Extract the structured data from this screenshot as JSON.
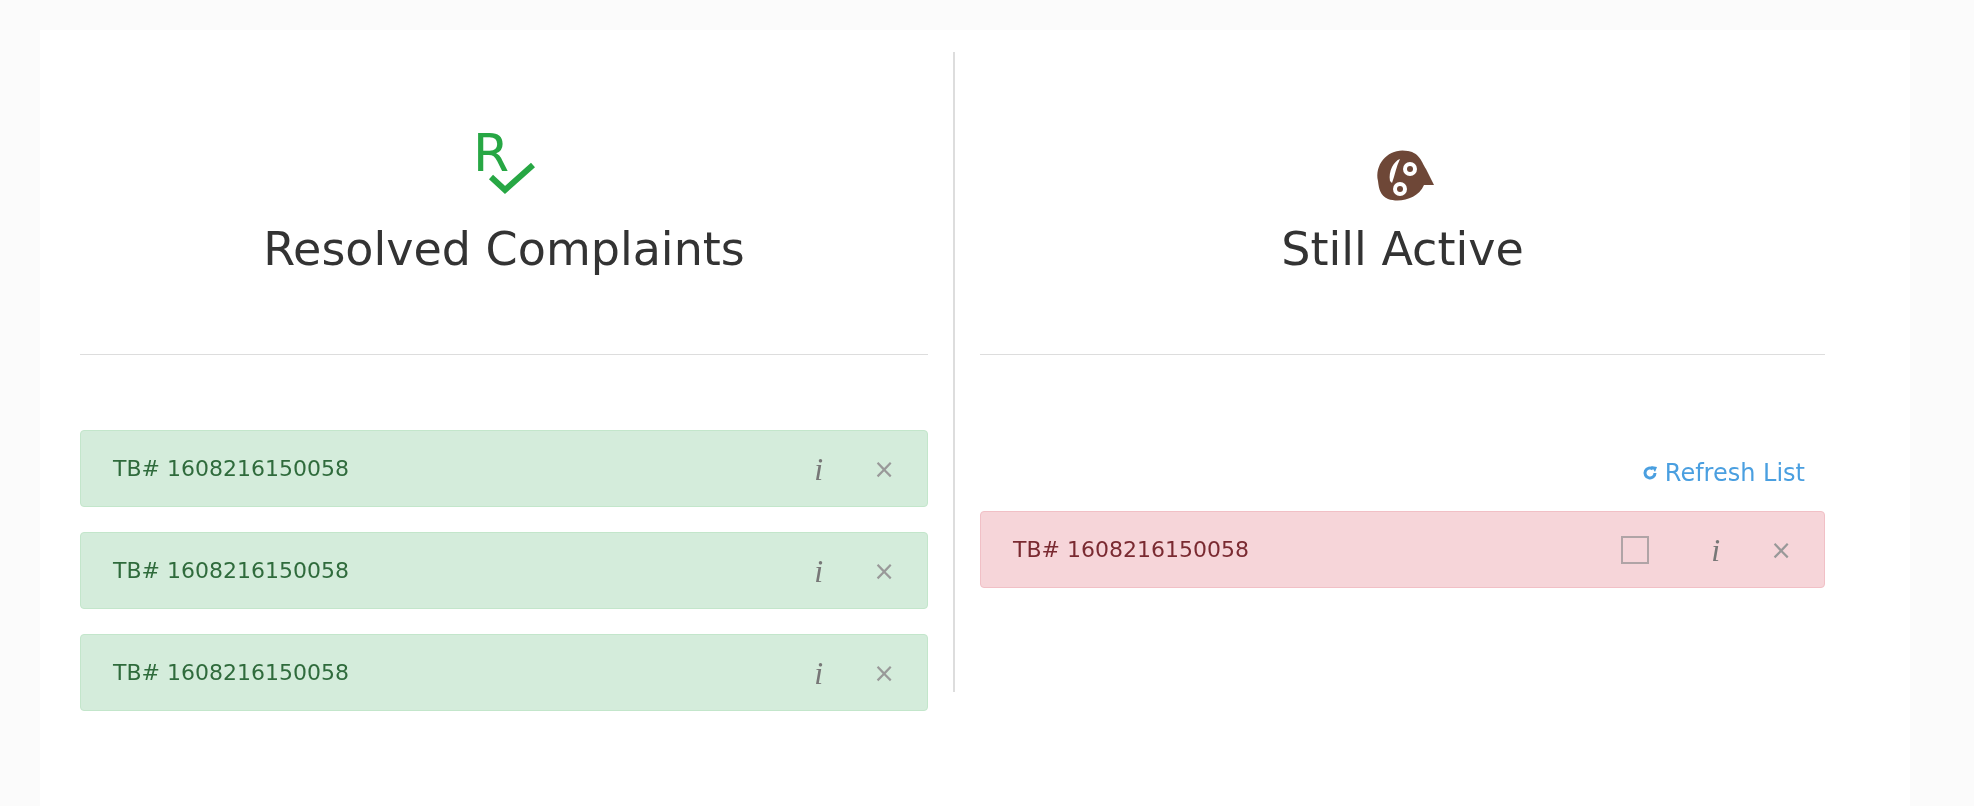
{
  "resolved": {
    "logo_letter": "R",
    "title": "Resolved Complaints",
    "items": [
      {
        "label": "TB# 1608216150058",
        "info": "i",
        "close": "×"
      },
      {
        "label": "TB# 1608216150058",
        "info": "i",
        "close": "×"
      },
      {
        "label": "TB# 1608216150058",
        "info": "i",
        "close": "×"
      }
    ]
  },
  "active": {
    "title": "Still Active",
    "refresh": "Refresh List",
    "items": [
      {
        "label": "TB# 1608216150058",
        "checked": false,
        "info": "i",
        "close": "×"
      }
    ]
  }
}
